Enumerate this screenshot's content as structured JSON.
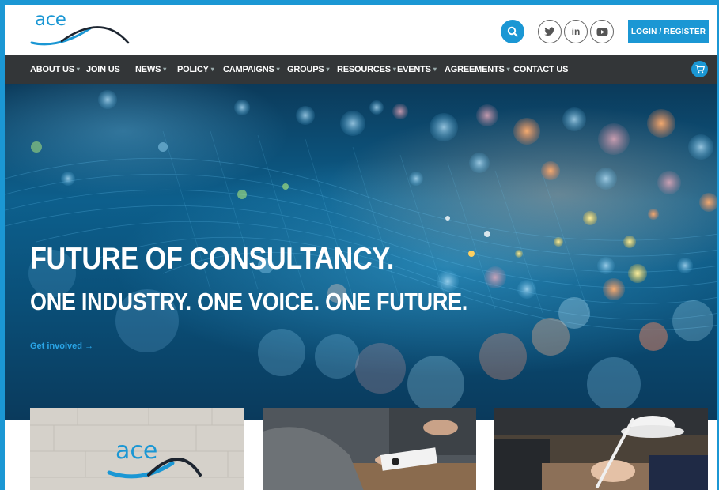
{
  "header": {
    "logo_text": "ace",
    "login_label": "LOGIN / REGISTER",
    "icons": {
      "search": "search-icon",
      "twitter": "twitter-icon",
      "linkedin": "linkedin-icon",
      "youtube": "youtube-icon",
      "cart": "cart-icon"
    },
    "linkedin_text": "in"
  },
  "nav": {
    "items": [
      {
        "label": "ABOUT US",
        "has_dropdown": true
      },
      {
        "label": "JOIN US",
        "has_dropdown": false
      },
      {
        "label": "NEWS",
        "has_dropdown": true
      },
      {
        "label": "POLICY",
        "has_dropdown": true
      },
      {
        "label": "CAMPAIGNS",
        "has_dropdown": true
      },
      {
        "label": "GROUPS",
        "has_dropdown": true
      },
      {
        "label": "RESOURCES",
        "has_dropdown": true
      },
      {
        "label": "EVENTS",
        "has_dropdown": true
      },
      {
        "label": "AGREEMENTS",
        "has_dropdown": true
      },
      {
        "label": "CONTACT US",
        "has_dropdown": false
      }
    ]
  },
  "hero": {
    "title": "FUTURE OF CONSULTANCY.",
    "subtitle": "ONE INDUSTRY. ONE VOICE. ONE FUTURE.",
    "link_label": "Get involved",
    "link_arrow": "→"
  },
  "cards": {
    "card1_logo_text": "ace"
  },
  "colors": {
    "accent": "#1b97d4",
    "nav_bg": "#333638",
    "text_light": "#ffffff"
  }
}
